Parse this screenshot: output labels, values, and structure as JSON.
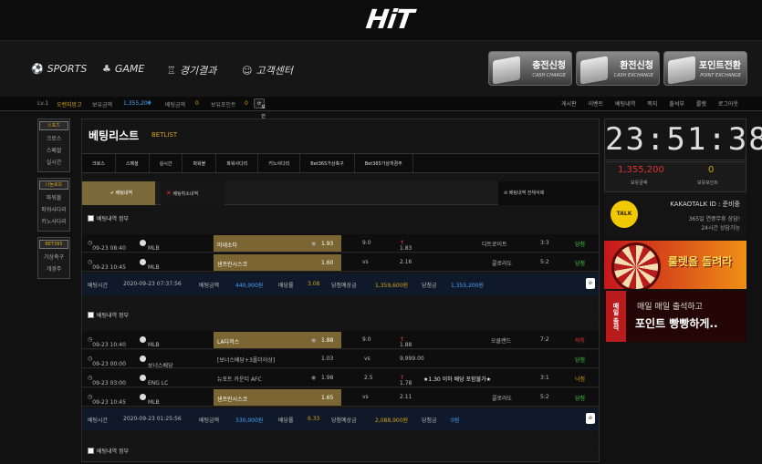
{
  "logo": "HiT",
  "nav": [
    {
      "label": "SPORTS",
      "icon": "soccer-ball-icon",
      "glyph": "⚽"
    },
    {
      "label": "GAME",
      "icon": "game-pieces-icon",
      "glyph": "♣"
    },
    {
      "label": "경기결과",
      "icon": "trophy-icon",
      "glyph": "🏆"
    },
    {
      "label": "고객센터",
      "icon": "headset-icon",
      "glyph": "☺"
    }
  ],
  "tiles": [
    {
      "title": "충전신청",
      "sub": "CASH CHARGE"
    },
    {
      "title": "환전신청",
      "sub": "CASH EXCHANGE"
    },
    {
      "title": "포인트전환",
      "sub": "POINT EXCHANGE"
    }
  ],
  "info": {
    "level": "Lv.1",
    "nick": "오렌지망고",
    "bal_label": "보유금액",
    "bal": "1,355,200",
    "bet_label": "베팅금액",
    "bet": "0",
    "pt_label": "보유포인트",
    "pt": "0",
    "pt_btn": "포인트 전환"
  },
  "toplinks": [
    "게시판",
    "이벤트",
    "베팅내역",
    "쪽지",
    "출석부",
    "룰렛",
    "로그아웃"
  ],
  "sidebar": [
    {
      "title": "스포츠",
      "items": [
        "크로스",
        "스페셜",
        "실시간"
      ]
    },
    {
      "title": "나눔로또",
      "items": [
        "파워볼",
        "파워사다리",
        "키노사다리"
      ]
    },
    {
      "title": "BET365",
      "items": [
        "가상축구",
        "개경주"
      ]
    }
  ],
  "betlist": {
    "title": "베팅리스트",
    "subtitle": "BETLIST",
    "tabs": [
      "크로스",
      "스페셜",
      "실시간",
      "파워볼",
      "파워사다리",
      "키노사다리",
      "Bet365가상축구",
      "Bet365가상개경주"
    ],
    "subtab_active": "베팅내역",
    "subtab_cancel": "베팅취소내역",
    "subtab_all": "베팅내역 전체삭제",
    "check_label": "베팅내역 정부",
    "foot_labels": {
      "time": "베팅시간",
      "amount": "베팅금액",
      "rate": "배당률",
      "expect": "당첨예상금",
      "win": "당첨금",
      "print": "내역보기"
    },
    "blocks": [
      {
        "rows": [
          {
            "time": "09-23 08:40",
            "league": "MLB",
            "home": "미네소타",
            "odds1": "1.93",
            "mid": "9.0",
            "odds2": "1.83",
            "up": true,
            "away": "디트로이트",
            "score": "3:3",
            "result": "당첨",
            "res": "win"
          },
          {
            "time": "09-23 10:45",
            "league": "MLB",
            "home": "샌프란시스코",
            "odds1": "1.60",
            "mid": "vs",
            "odds2": "2.16",
            "up": false,
            "away": "콜로라도",
            "score": "5:2",
            "result": "당첨",
            "res": "win"
          }
        ],
        "footer": {
          "time": "2020-09-23 07:37:56",
          "amount": "440,000원",
          "rate": "3.08",
          "expect": "1,359,600원",
          "win": "1,355,200원"
        }
      },
      {
        "rows": [
          {
            "time": "09-23 10:40",
            "league": "MLB",
            "home": "LA다저스",
            "odds1": "1.88",
            "mid": "9.0",
            "odds2": "1.88",
            "up": true,
            "away": "오클랜드",
            "score": "7:2",
            "result": "적특",
            "res": "lose"
          },
          {
            "time": "09-23 00:00",
            "league": "보너스배당",
            "home": "[보너스배당+3폴더이상]",
            "odds1": "1.03",
            "mid": "vs",
            "odds2": "9,999.00",
            "up": false,
            "away": "",
            "score": "",
            "result": "당첨",
            "res": "win"
          },
          {
            "time": "09-23 03:00",
            "league": "ENG LC",
            "home": "뉴포트 카운티 AFC",
            "odds1": "1.98",
            "mid": "2.5",
            "odds2": "1.78",
            "up": true,
            "away": "★1.30 이하 배당 포함불가★",
            "score": "3:1",
            "result": "낙첨",
            "res": "out"
          },
          {
            "time": "09-23 10:45",
            "league": "MLB",
            "home": "샌프란시스코",
            "odds1": "1.65",
            "mid": "vs",
            "odds2": "2.11",
            "up": false,
            "away": "콜로라도",
            "score": "5:2",
            "result": "당첨",
            "res": "win"
          }
        ],
        "footer": {
          "time": "2020-09-23 01:25:56",
          "amount": "330,000원",
          "rate": "6.33",
          "expect": "2,088,900원",
          "win": "0원"
        }
      }
    ]
  },
  "clock": "23:51:38",
  "balance": {
    "money": "1,355,200",
    "money_label": "보유금액",
    "points": "0",
    "points_label": "보유포인트"
  },
  "kakao": {
    "logo": "TALK",
    "id": "KAKAOTALK ID : 준비중",
    "line1": "365일 연중무휴 상담!",
    "line2": "24시간 상담가능"
  },
  "banner1": "룰렛을 돌려라",
  "banner2": {
    "tag": "매일 출석",
    "line1": "매일 매일 출석하고",
    "line2": "포인트 빵빵하게.."
  },
  "colors": {
    "gold": "#7b6633",
    "accent": "#d4a017",
    "win": "#43c943",
    "lose": "#e23333"
  }
}
